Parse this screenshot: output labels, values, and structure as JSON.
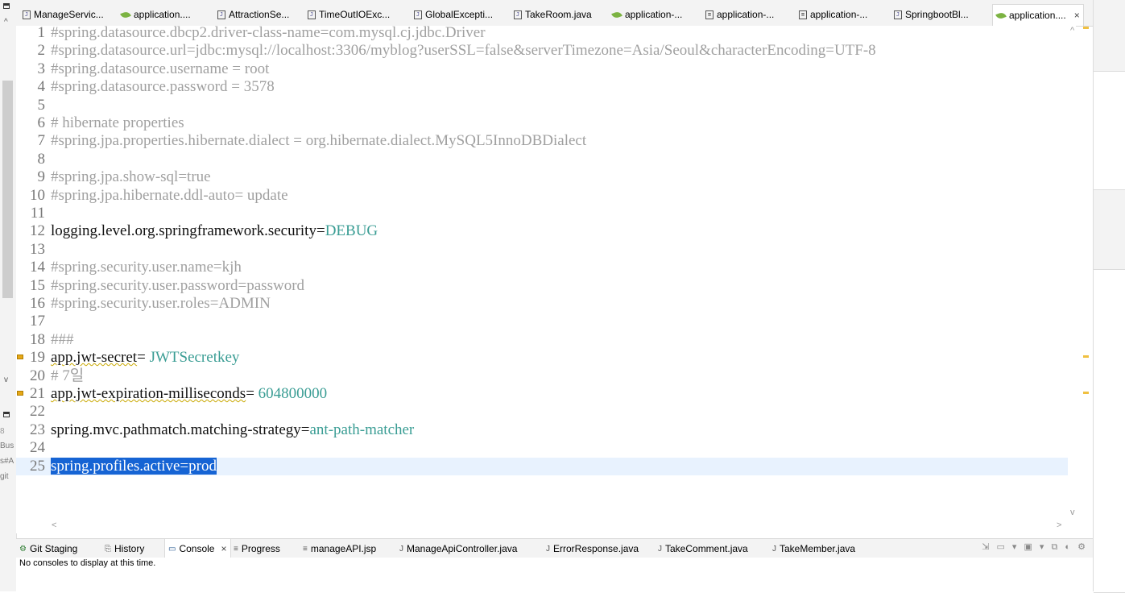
{
  "editor_tabs": [
    {
      "label": "ManageServic...",
      "icon": "java-file-icon"
    },
    {
      "label": "application....",
      "icon": "spring-leaf-icon"
    },
    {
      "label": "AttractionSe...",
      "icon": "java-file-icon"
    },
    {
      "label": "TimeOutIOExc...",
      "icon": "java-file-icon"
    },
    {
      "label": "GlobalExcepti...",
      "icon": "java-file-icon"
    },
    {
      "label": "TakeRoom.java",
      "icon": "java-file-icon"
    },
    {
      "label": "application-...",
      "icon": "spring-leaf-icon"
    },
    {
      "label": "application-...",
      "icon": "properties-file-icon"
    },
    {
      "label": "application-...",
      "icon": "properties-file-icon"
    },
    {
      "label": "SpringbootBl...",
      "icon": "java-file-icon"
    },
    {
      "label": "application....",
      "icon": "spring-leaf-icon"
    }
  ],
  "close_glyph": "×",
  "lines": [
    {
      "n": "1",
      "type": "comment",
      "text": "#spring.datasource.dbcp2.driver-class-name=com.mysql.cj.jdbc.Driver"
    },
    {
      "n": "2",
      "type": "comment",
      "text": "#spring.datasource.url=jdbc:mysql://localhost:3306/myblog?userSSL=false&serverTimezone=Asia/Seoul&characterEncoding=UTF-8"
    },
    {
      "n": "3",
      "type": "comment",
      "text": "#spring.datasource.username = root"
    },
    {
      "n": "4",
      "type": "comment",
      "text": "#spring.datasource.password = 3578"
    },
    {
      "n": "5",
      "type": "blank",
      "text": ""
    },
    {
      "n": "6",
      "type": "comment",
      "text": "# hibernate properties"
    },
    {
      "n": "7",
      "type": "comment",
      "text": "#spring.jpa.properties.hibernate.dialect = org.hibernate.dialect.MySQL5InnoDBDialect"
    },
    {
      "n": "8",
      "type": "blank",
      "text": ""
    },
    {
      "n": "9",
      "type": "comment",
      "text": "#spring.jpa.show-sql=true"
    },
    {
      "n": "10",
      "type": "comment",
      "text": "#spring.jpa.hibernate.ddl-auto= update"
    },
    {
      "n": "11",
      "type": "blank",
      "text": ""
    },
    {
      "n": "12",
      "type": "prop",
      "key": "logging.level.org.springframework.security",
      "sep": "=",
      "value": "DEBUG"
    },
    {
      "n": "13",
      "type": "blank",
      "text": ""
    },
    {
      "n": "14",
      "type": "comment",
      "text": "#spring.security.user.name=kjh"
    },
    {
      "n": "15",
      "type": "comment",
      "text": "#spring.security.user.password=password"
    },
    {
      "n": "16",
      "type": "comment",
      "text": "#spring.security.user.roles=ADMIN"
    },
    {
      "n": "17",
      "type": "blank",
      "text": ""
    },
    {
      "n": "18",
      "type": "comment",
      "text": "###"
    },
    {
      "n": "19",
      "type": "prop",
      "key": "app.jwt-secret",
      "sep": "= ",
      "value": "JWTSecretkey",
      "warning": true
    },
    {
      "n": "20",
      "type": "comment",
      "text": "# 7일"
    },
    {
      "n": "21",
      "type": "prop",
      "key": "app.jwt-expiration-milliseconds",
      "sep": "= ",
      "value": "604800000",
      "warning": true
    },
    {
      "n": "22",
      "type": "blank",
      "text": ""
    },
    {
      "n": "23",
      "type": "prop",
      "key": "spring.mvc.pathmatch.matching-strategy",
      "sep": "=",
      "value": "ant-path-matcher"
    },
    {
      "n": "24",
      "type": "blank",
      "text": ""
    },
    {
      "n": "25",
      "type": "selected",
      "text": "spring.profiles.active=prod"
    }
  ],
  "bottom_tabs": [
    {
      "label": "Git Staging",
      "icon": "git-staging-icon"
    },
    {
      "label": "History",
      "icon": "history-icon"
    },
    {
      "label": "Console",
      "icon": "console-icon",
      "active": true
    },
    {
      "label": "Progress",
      "icon": "progress-icon"
    },
    {
      "label": "manageAPI.jsp",
      "icon": "jsp-file-icon"
    },
    {
      "label": "ManageApiController.java",
      "icon": "java-file-icon"
    },
    {
      "label": "ErrorResponse.java",
      "icon": "java-file-icon"
    },
    {
      "label": "TakeComment.java",
      "icon": "java-file-icon"
    },
    {
      "label": "TakeMember.java",
      "icon": "java-file-icon"
    }
  ],
  "console_message": "No consoles to display at this time.",
  "left_fragments": [
    "Bus",
    "s#A",
    "git"
  ]
}
